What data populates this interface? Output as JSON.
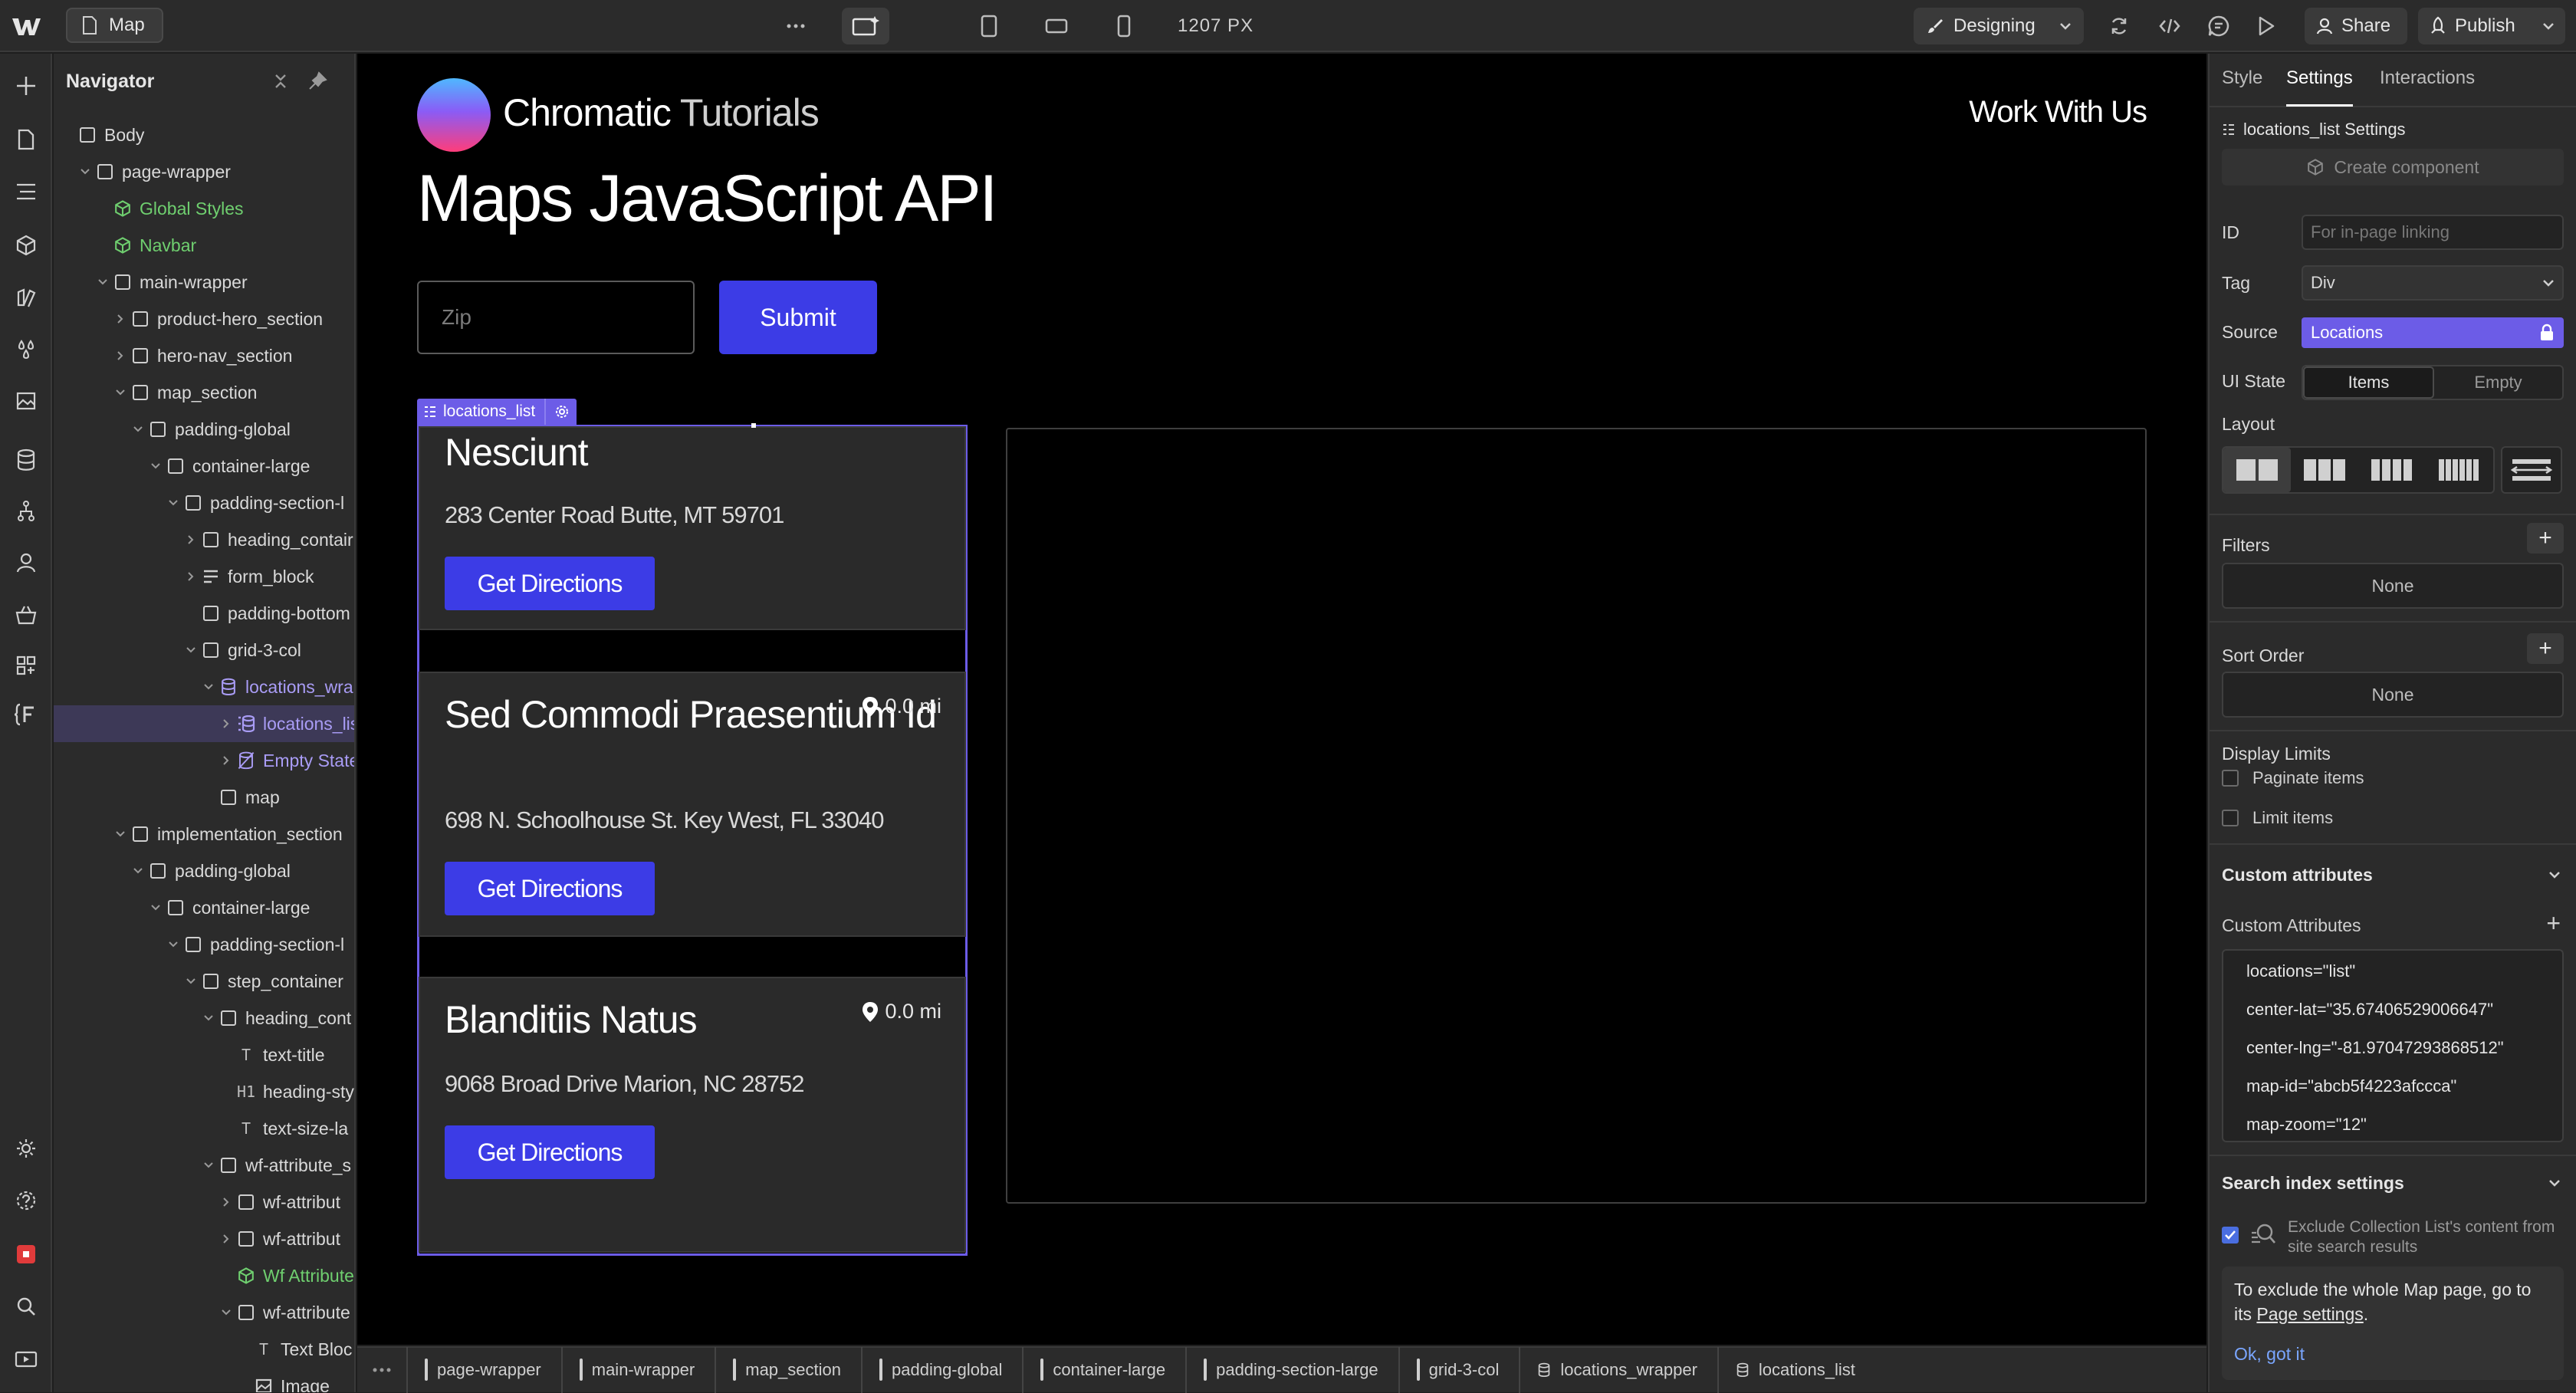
{
  "topbar": {
    "page_name": "Map",
    "viewport_width": "1207 PX",
    "mode": "Designing",
    "share": "Share",
    "publish": "Publish"
  },
  "navigator": {
    "title": "Navigator",
    "items": [
      {
        "label": "Body",
        "depth": 0,
        "caret": "",
        "icon": "box",
        "style": ""
      },
      {
        "label": "page-wrapper",
        "depth": 1,
        "caret": "down",
        "icon": "box",
        "style": ""
      },
      {
        "label": "Global Styles",
        "depth": 2,
        "caret": "",
        "icon": "component",
        "style": "green"
      },
      {
        "label": "Navbar",
        "depth": 2,
        "caret": "",
        "icon": "component",
        "style": "green"
      },
      {
        "label": "main-wrapper",
        "depth": 2,
        "caret": "down",
        "icon": "box",
        "style": ""
      },
      {
        "label": "product-hero_section",
        "depth": 3,
        "caret": "right",
        "icon": "box",
        "style": ""
      },
      {
        "label": "hero-nav_section",
        "depth": 3,
        "caret": "right",
        "icon": "box",
        "style": ""
      },
      {
        "label": "map_section",
        "depth": 3,
        "caret": "down",
        "icon": "box",
        "style": ""
      },
      {
        "label": "padding-global",
        "depth": 4,
        "caret": "down",
        "icon": "box",
        "style": ""
      },
      {
        "label": "container-large",
        "depth": 5,
        "caret": "down",
        "icon": "box",
        "style": ""
      },
      {
        "label": "padding-section-l",
        "depth": 6,
        "caret": "down",
        "icon": "box",
        "style": ""
      },
      {
        "label": "heading_contair",
        "depth": 7,
        "caret": "right",
        "icon": "box",
        "style": ""
      },
      {
        "label": "form_block",
        "depth": 7,
        "caret": "right",
        "icon": "form",
        "style": ""
      },
      {
        "label": "padding-bottom",
        "depth": 7,
        "caret": "",
        "icon": "box",
        "style": ""
      },
      {
        "label": "grid-3-col",
        "depth": 7,
        "caret": "down",
        "icon": "box",
        "style": ""
      },
      {
        "label": "locations_wra",
        "depth": 8,
        "caret": "down",
        "icon": "cms",
        "style": "purple"
      },
      {
        "label": "locations_lis",
        "depth": 9,
        "caret": "right",
        "icon": "list",
        "style": "purple",
        "selected": true
      },
      {
        "label": "Empty State",
        "depth": 9,
        "caret": "right",
        "icon": "empty",
        "style": "purple"
      },
      {
        "label": "map",
        "depth": 8,
        "caret": "",
        "icon": "box",
        "style": ""
      },
      {
        "label": "implementation_section",
        "depth": 3,
        "caret": "down",
        "icon": "box",
        "style": ""
      },
      {
        "label": "padding-global",
        "depth": 4,
        "caret": "down",
        "icon": "box",
        "style": ""
      },
      {
        "label": "container-large",
        "depth": 5,
        "caret": "down",
        "icon": "box",
        "style": ""
      },
      {
        "label": "padding-section-l",
        "depth": 6,
        "caret": "down",
        "icon": "box",
        "style": ""
      },
      {
        "label": "step_container",
        "depth": 7,
        "caret": "down",
        "icon": "box",
        "style": ""
      },
      {
        "label": "heading_cont",
        "depth": 8,
        "caret": "down",
        "icon": "box",
        "style": ""
      },
      {
        "label": "text-title",
        "depth": 9,
        "caret": "",
        "icon": "T",
        "style": ""
      },
      {
        "label": "heading-sty",
        "depth": 9,
        "caret": "",
        "icon": "H1",
        "style": ""
      },
      {
        "label": "text-size-la",
        "depth": 9,
        "caret": "",
        "icon": "T",
        "style": ""
      },
      {
        "label": "wf-attribute_s",
        "depth": 8,
        "caret": "down",
        "icon": "box",
        "style": ""
      },
      {
        "label": "wf-attribut",
        "depth": 9,
        "caret": "right",
        "icon": "box",
        "style": ""
      },
      {
        "label": "wf-attribut",
        "depth": 9,
        "caret": "right",
        "icon": "box",
        "style": ""
      },
      {
        "label": "Wf Attribute",
        "depth": 9,
        "caret": "",
        "icon": "component",
        "style": "green"
      },
      {
        "label": "wf-attribute",
        "depth": 9,
        "caret": "down",
        "icon": "box",
        "style": ""
      },
      {
        "label": "Text Bloc",
        "depth": 10,
        "caret": "",
        "icon": "T",
        "style": ""
      },
      {
        "label": "Image",
        "depth": 10,
        "caret": "",
        "icon": "image",
        "style": ""
      }
    ]
  },
  "canvas": {
    "brand_strong": "Chromatic",
    "brand_light": " Tutorials",
    "work_link": "Work With Us",
    "heading": "Maps JavaScript API",
    "zip_placeholder": "Zip",
    "submit": "Submit",
    "selection_label": "locations_list",
    "locations": [
      {
        "name": "Nesciunt",
        "address": "283 Center Road Butte, MT 59701",
        "distance": "",
        "button": "Get Directions"
      },
      {
        "name": "Sed Commodi Praesentium Id",
        "address": "698 N. Schoolhouse St. Key West, FL 33040",
        "distance": "0.0 mi",
        "button": "Get Directions"
      },
      {
        "name": "Blanditiis Natus",
        "address": "9068 Broad Drive Marion, NC 28752",
        "distance": "0.0 mi",
        "button": "Get Directions"
      }
    ]
  },
  "breadcrumbs": [
    "page-wrapper",
    "main-wrapper",
    "map_section",
    "padding-global",
    "container-large",
    "padding-section-large",
    "grid-3-col",
    "locations_wrapper",
    "locations_list"
  ],
  "panel": {
    "tabs": [
      "Style",
      "Settings",
      "Interactions"
    ],
    "active_tab": "Settings",
    "settings_title": "locations_list Settings",
    "create_component": "Create component",
    "id_label": "ID",
    "id_placeholder": "For in-page linking",
    "tag_label": "Tag",
    "tag_value": "Div",
    "source_label": "Source",
    "source_value": "Locations",
    "ui_state_label": "UI State",
    "ui_state_items": "Items",
    "ui_state_empty": "Empty",
    "layout_label": "Layout",
    "filters_label": "Filters",
    "filters_value": "None",
    "sort_label": "Sort Order",
    "sort_value": "None",
    "display_limits_label": "Display Limits",
    "paginate_label": "Paginate items",
    "limit_label": "Limit items",
    "custom_attributes_title": "Custom attributes",
    "custom_attributes_label": "Custom Attributes",
    "attributes": [
      "locations=\"list\"",
      "center-lat=\"35.67406529006647\"",
      "center-lng=\"-81.97047293868512\"",
      "map-id=\"abcb5f4223afccca\"",
      "map-zoom=\"12\""
    ],
    "search_title": "Search index settings",
    "search_exclude": "Exclude Collection List's content from site search results",
    "note_pre": "To exclude the whole Map page, go to its ",
    "note_link": "Page settings",
    "note_post": ".",
    "note_ok": "Ok, got it"
  },
  "colors": {
    "accent": "#3c3ce6",
    "selection": "#6c5ce7",
    "component_green": "#6fcf6f",
    "cms_purple": "#a99cf5"
  }
}
